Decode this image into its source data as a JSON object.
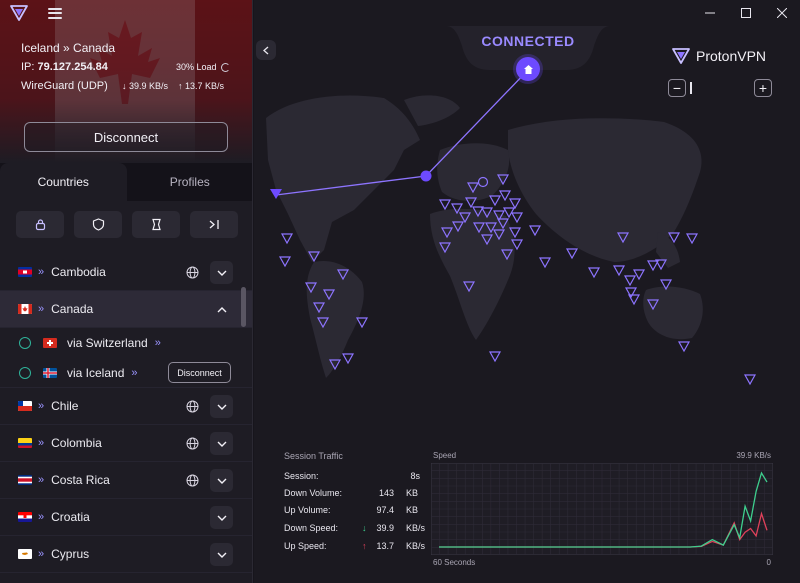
{
  "connection": {
    "route": "Iceland » Canada",
    "ip_label": "IP:",
    "ip": "79.127.254.84",
    "load": "30% Load",
    "protocol": "WireGuard (UDP)",
    "download": "↓  39.9 KB/s",
    "upload": "↑  13.7 KB/s",
    "disconnect_label": "Disconnect"
  },
  "tabs": [
    {
      "label": "Countries",
      "active": true
    },
    {
      "label": "Profiles",
      "active": false
    }
  ],
  "filters": [
    "secure-core-icon",
    "shield-icon",
    "p2p-icon",
    "tor-icon"
  ],
  "countries": [
    {
      "name": "Cambodia",
      "flag": "cambodia",
      "globe": true,
      "expanded": false
    },
    {
      "name": "Canada",
      "flag": "canada",
      "globe": false,
      "expanded": true,
      "via": [
        {
          "label": "via Switzerland",
          "flag": "switzerland",
          "connected": false
        },
        {
          "label": "via Iceland",
          "flag": "iceland",
          "connected": true,
          "action": "Disconnect"
        }
      ]
    },
    {
      "name": "Chile",
      "flag": "chile",
      "globe": true,
      "expanded": false
    },
    {
      "name": "Colombia",
      "flag": "colombia",
      "globe": true,
      "expanded": false
    },
    {
      "name": "Costa Rica",
      "flag": "costa-rica",
      "globe": true,
      "expanded": false
    },
    {
      "name": "Croatia",
      "flag": "croatia",
      "globe": false,
      "expanded": false
    },
    {
      "name": "Cyprus",
      "flag": "cyprus",
      "globe": false,
      "expanded": false
    }
  ],
  "map": {
    "status": "CONNECTED",
    "brand_1": "Proton",
    "brand_2": "VPN",
    "zoom_in": "+",
    "zoom_out": "−",
    "accent": "#6d4aff"
  },
  "traffic": {
    "title": "Session Traffic",
    "rows": [
      {
        "label": "Session:",
        "value": "8s",
        "unit": ""
      },
      {
        "label": "Down Volume:",
        "value": "143",
        "unit": "KB"
      },
      {
        "label": "Up Volume:",
        "value": "97.4",
        "unit": "KB"
      },
      {
        "label": "Down Speed:",
        "value": "39.9",
        "unit": "KB/s",
        "arrow": "↓"
      },
      {
        "label": "Up Speed:",
        "value": "13.7",
        "unit": "KB/s",
        "arrow": "↑"
      }
    ],
    "speed_title": "Speed",
    "speed_max": "39.9  KB/s",
    "speed_window": "60 Seconds",
    "speed_zero": "0"
  },
  "chart_data": {
    "type": "line",
    "title": "Speed",
    "xlabel": "60 Seconds",
    "ylim": [
      0,
      39.9
    ],
    "x": [
      0,
      46,
      48,
      50,
      52,
      54,
      55,
      56,
      57,
      58,
      59,
      60
    ],
    "series": [
      {
        "name": "Down",
        "color": "#3ecf8e",
        "values": [
          0,
          0,
          0.5,
          4,
          1,
          12,
          5,
          22,
          14,
          30,
          39.9,
          35
        ]
      },
      {
        "name": "Up",
        "color": "#e0415a",
        "values": [
          0,
          0,
          0.3,
          3,
          1,
          13,
          4,
          8,
          10,
          6,
          18,
          9
        ]
      }
    ]
  }
}
